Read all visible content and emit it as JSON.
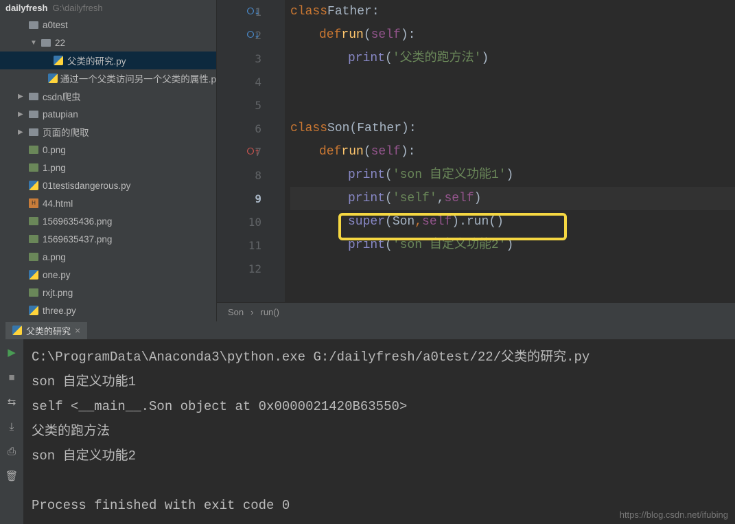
{
  "sidebar": {
    "project_name": "dailyfresh",
    "project_path": "G:\\dailyfresh",
    "items": [
      {
        "label": "a0test",
        "type": "folder",
        "indent": 1,
        "arrow": "",
        "open": true
      },
      {
        "label": "22",
        "type": "folder",
        "indent": 2,
        "arrow": "▼",
        "open": true
      },
      {
        "label": "父类的研究.py",
        "type": "py",
        "indent": 3,
        "selected": true
      },
      {
        "label": "通过一个父类访问另一个父类的属性.p",
        "type": "py",
        "indent": 3
      },
      {
        "label": "csdn爬虫",
        "type": "folder",
        "indent": 1,
        "arrow": "▶"
      },
      {
        "label": "patupian",
        "type": "folder",
        "indent": 1,
        "arrow": "▶"
      },
      {
        "label": "页面的爬取",
        "type": "folder",
        "indent": 1,
        "arrow": "▶"
      },
      {
        "label": "0.png",
        "type": "img",
        "indent": 1
      },
      {
        "label": "1.png",
        "type": "img",
        "indent": 1
      },
      {
        "label": "01testisdangerous.py",
        "type": "py",
        "indent": 1
      },
      {
        "label": "44.html",
        "type": "html",
        "indent": 1
      },
      {
        "label": "1569635436.png",
        "type": "img",
        "indent": 1
      },
      {
        "label": "1569635437.png",
        "type": "img",
        "indent": 1
      },
      {
        "label": "a.png",
        "type": "img",
        "indent": 1
      },
      {
        "label": "one.py",
        "type": "py",
        "indent": 1
      },
      {
        "label": "rxjt.png",
        "type": "img",
        "indent": 1
      },
      {
        "label": "three.py",
        "type": "py",
        "indent": 1
      }
    ]
  },
  "editor": {
    "lines": [
      "1",
      "2",
      "3",
      "4",
      "5",
      "6",
      "7",
      "8",
      "9",
      "10",
      "11",
      "12"
    ],
    "current_line": "9",
    "code": {
      "l1": {
        "kw": "class",
        "cls": " Father:"
      },
      "l2": {
        "kw": "def",
        "fn": " run",
        "p": "(",
        "self": "self",
        "c": "):"
      },
      "l3": {
        "builtin": "print",
        "p1": "(",
        "str": "'父类的跑方法'",
        "p2": ")"
      },
      "l6": {
        "kw": "class",
        "cls": " Son(Father):"
      },
      "l7": {
        "kw": "def",
        "fn": " run",
        "p": "(",
        "self": "self",
        "c": "):"
      },
      "l8": {
        "builtin": "print",
        "p1": "(",
        "str": "'son 自定义功能1'",
        "p2": ")"
      },
      "l9": {
        "builtin": "print",
        "p1": "(",
        "str": "'self'",
        "comma": ", ",
        "self": "self",
        "p2": ")"
      },
      "l10": {
        "builtin": "super",
        "p1": "(Son",
        "comma": ",",
        "self": "self",
        "p2": ").run()"
      },
      "l11": {
        "builtin": "print",
        "p1": "(",
        "str": "'son 自定义功能2'",
        "p2": ")"
      }
    },
    "breadcrumb": {
      "a": "Son",
      "sep": "›",
      "b": "run()"
    }
  },
  "console": {
    "tab_label": "父类的研究",
    "output": "C:\\ProgramData\\Anaconda3\\python.exe G:/dailyfresh/a0test/22/父类的研究.py\nson 自定义功能1\nself <__main__.Son object at 0x0000021420B63550>\n父类的跑方法\nson 自定义功能2\n\nProcess finished with exit code 0"
  },
  "watermark": "https://blog.csdn.net/ifubing"
}
